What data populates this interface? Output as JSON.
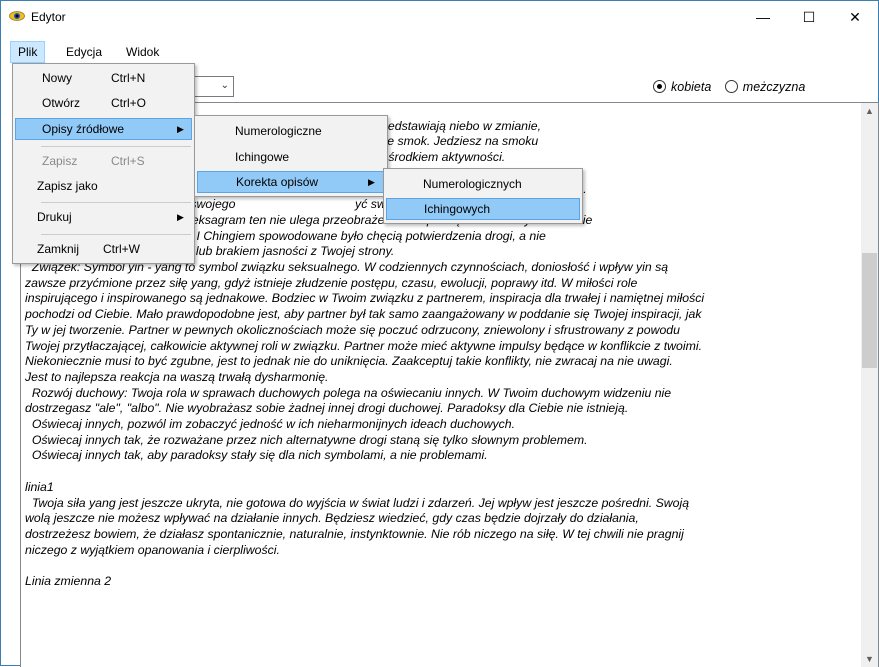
{
  "window": {
    "title": "Edytor",
    "minimize": "—",
    "maximize": "☐",
    "close": "✕"
  },
  "menubar": {
    "plik": "Plik",
    "edycja": "Edycja",
    "widok": "Widok"
  },
  "toolbar": {
    "gender_female": "kobieta",
    "gender_male": "meżczyzna",
    "selected": "kobieta"
  },
  "file_menu": {
    "new": "Nowy",
    "new_sc": "Ctrl+N",
    "open": "Otwórz",
    "open_sc": "Ctrl+O",
    "sources": "Opisy źródłowe",
    "save": "Zapisz",
    "save_sc": "Ctrl+S",
    "save_as": "Zapisz jako",
    "print": "Drukuj",
    "close": "Zamknij",
    "close_sc": "Ctrl+W"
  },
  "sources_submenu": {
    "numerological": "Numerologiczne",
    "iching": "Ichingowe",
    "correction": "Korekta opisów"
  },
  "correction_submenu": {
    "numerological": "Numerologicznych",
    "iching": "Ichingowych"
  },
  "text": {
    "lines": [
      "                                m 1",
      "                                        ieje tylko jedno niebo, te dwa trigramy przedstawiają niebo w zmianie,",
      "                                        rpaną, niezniszczalną odnowę symbolizuje smok. Jedziesz na smoku",
      "                                        spirująca, pełna mocy, duchową. Jesteś ośrodkiem aktywności.",
      "                                                                                            orzysz swój świat tak jak \"niebo niżej\"",
      "                  a się (jak niebo przyszłości)                                      m ruchu, w harmonii ze wszechświatem.",
      "                  ie możesz zmienić swojego                                   yć swojej siły. Odzwierciedlasz stałość,",
      "                  ść siły yang. Jeśli heksagram ten nie ulega przeobrażeniu za sprawą linii zmiennych i wiernie",
      "                  konsultowanie się z I Chingiem spowodowane było chęcią potwierdzenia drogi, a nie",
      "niezdecydowaniem, wahaniem lub brakiem jasności z Twojej strony.",
      "  Związek: Symbol yin - yang to symbol związku seksualnego. W codziennych czynnościach, doniosłość i wpływ yin są",
      "zawsze przyćmione przez siłę yang, gdyż istnieje złudzenie postępu, czasu, ewolucji, poprawy itd. W miłości role",
      "inspirującego i inspirowanego są jednakowe. Bodziec w Twoim związku z partnerem, inspiracja dla trwałej i namiętnej miłości",
      "pochodzi od Ciebie. Mało prawdopodobne jest, aby partner był tak samo zaangażowany w poddanie się Twojej inspiracji, jak",
      "Ty w jej tworzenie. Partner w pewnych okolicznościach może się poczuć odrzucony, zniewolony i sfrustrowany z powodu",
      "Twojej przytłaczającej, całkowicie aktywnej roli w związku. Partner może mieć aktywne impulsy będące w konflikcie z twoimi.",
      "Niekoniecznie musi to być zgubne, jest to jednak nie do uniknięcia. Zaakceptuj takie konflikty, nie zwracaj na nie uwagi.",
      "Jest to najlepsza reakcja na waszą trwałą dysharmonię.",
      "  Rozwój duchowy: Twoja rola w sprawach duchowych polega na oświecaniu innych. W Twoim duchowym widzeniu nie",
      "dostrzegasz \"ale\", \"albo\". Nie wyobrażasz sobie żadnej innej drogi duchowej. Paradoksy dla Ciebie nie istnieją.",
      "  Oświecaj innych, pozwól im zobaczyć jedność w ich nieharmonijnych ideach duchowych.",
      "  Oświecaj innych tak, że rozważane przez nich alternatywne drogi staną się tylko słownym problemem.",
      "  Oświecaj innych tak, aby paradoksy stały się dla nich symbolami, a nie problemami.",
      "",
      "linia1",
      "  Twoja siła yang jest jeszcze ukryta, nie gotowa do wyjścia w świat ludzi i zdarzeń. Jej wpływ jest jeszcze pośredni. Swoją",
      "wolą jeszcze nie możesz wpływać na działanie innych. Będziesz wiedzieć, gdy czas będzie dojrzały do działania,",
      "dostrzeżesz bowiem, że działasz spontanicznie, naturalnie, instynktownie. Nie rób niczego na siłę. W tej chwili nie pragnij",
      "niczego z wyjątkiem opanowania i cierpliwości.",
      "",
      "Linia zmienna 2"
    ]
  }
}
